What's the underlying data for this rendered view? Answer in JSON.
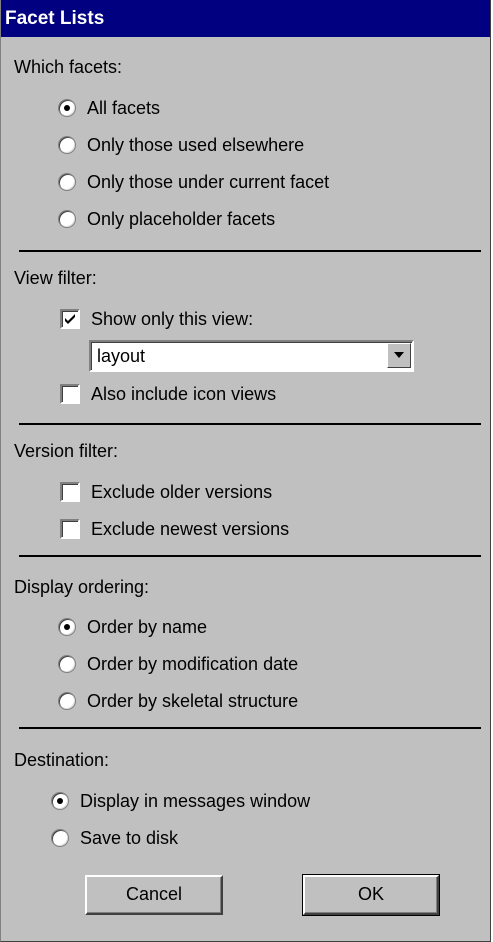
{
  "dialog": {
    "title": "Facet Lists"
  },
  "which_facets": {
    "heading": "Which facets:",
    "options": [
      {
        "label": "All facets",
        "selected": true
      },
      {
        "label": "Only those used elsewhere",
        "selected": false
      },
      {
        "label": "Only those under current facet",
        "selected": false
      },
      {
        "label": "Only placeholder facets",
        "selected": false
      }
    ]
  },
  "view_filter": {
    "heading": "View filter:",
    "show_only_view": {
      "label": "Show only this view:",
      "checked": true
    },
    "view_select": {
      "value": "layout"
    },
    "include_icon_views": {
      "label": "Also include icon views",
      "checked": false
    }
  },
  "version_filter": {
    "heading": "Version filter:",
    "exclude_older": {
      "label": "Exclude older versions",
      "checked": false
    },
    "exclude_newest": {
      "label": "Exclude newest versions",
      "checked": false
    }
  },
  "display_ordering": {
    "heading": "Display ordering:",
    "options": [
      {
        "label": "Order by name",
        "selected": true
      },
      {
        "label": "Order by modification date",
        "selected": false
      },
      {
        "label": "Order by skeletal structure",
        "selected": false
      }
    ]
  },
  "destination": {
    "heading": "Destination:",
    "options": [
      {
        "label": "Display in messages window",
        "selected": true
      },
      {
        "label": "Save to disk",
        "selected": false
      }
    ]
  },
  "buttons": {
    "cancel": "Cancel",
    "ok": "OK"
  }
}
